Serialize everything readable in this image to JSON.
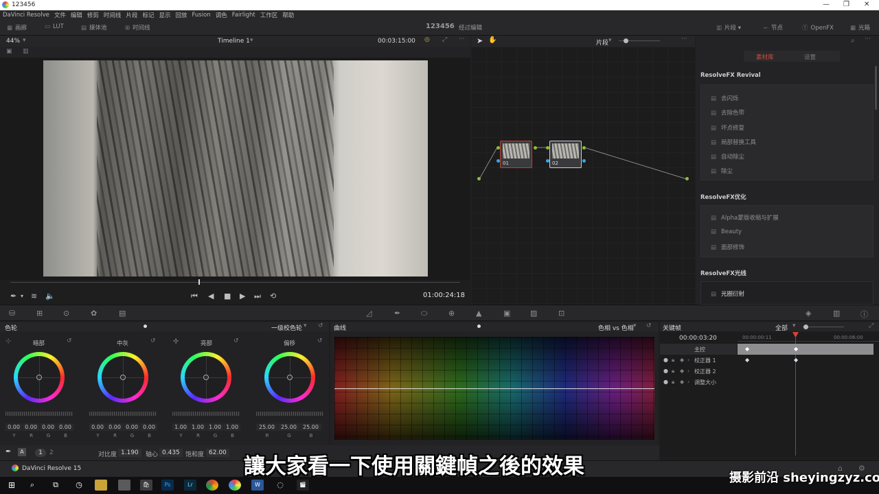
{
  "window": {
    "title": "123456"
  },
  "menu": [
    "DaVinci Resolve",
    "文件",
    "编辑",
    "修剪",
    "时间线",
    "片段",
    "标记",
    "显示",
    "回放",
    "Fusion",
    "调色",
    "Fairlight",
    "工作区",
    "帮助"
  ],
  "toolbar": {
    "left": [
      "画廊",
      "LUT",
      "媒体池",
      "时间线"
    ],
    "project": "123456",
    "status": "经过编辑",
    "right": [
      "片段",
      "节点",
      "OpenFX",
      "光箱"
    ]
  },
  "viewer": {
    "zoom": "44%",
    "timeline": "Timeline 1",
    "duration": "00:03:15:00",
    "timecode": "01:00:24:18"
  },
  "node_editor": {
    "mode": "片段",
    "nodes": [
      {
        "label": "01"
      },
      {
        "label": "02"
      }
    ]
  },
  "effects": {
    "tabs": [
      "素材库",
      "设置"
    ],
    "groups": [
      {
        "title": "ResolveFX Revival",
        "items": [
          "去闪烁",
          "去除色带",
          "坏点修复",
          "局部替换工具",
          "自动除尘",
          "除尘"
        ]
      },
      {
        "title": "ResolveFX优化",
        "items": [
          "Alpha蒙版收缩与扩展",
          "Beauty",
          "面部修饰"
        ]
      },
      {
        "title": "ResolveFX光线",
        "items": [
          "光圈衍射"
        ]
      }
    ]
  },
  "color_wheels": {
    "panel": "色轮",
    "mode": "一级校色轮",
    "wheels": [
      {
        "name": "暗部",
        "values": [
          "0.00",
          "0.00",
          "0.00",
          "0.00"
        ],
        "channels": [
          "Y",
          "R",
          "G",
          "B"
        ]
      },
      {
        "name": "中灰",
        "values": [
          "0.00",
          "0.00",
          "0.00",
          "0.00"
        ],
        "channels": [
          "Y",
          "R",
          "G",
          "B"
        ]
      },
      {
        "name": "亮部",
        "values": [
          "1.00",
          "1.00",
          "1.00",
          "1.00"
        ],
        "channels": [
          "Y",
          "R",
          "G",
          "B"
        ]
      },
      {
        "name": "偏移",
        "values": [
          "25.00",
          "25.00",
          "25.00"
        ],
        "channels": [
          "R",
          "G",
          "B"
        ]
      }
    ],
    "pages": [
      "1",
      "2"
    ],
    "adjust": [
      {
        "label": "对比度",
        "value": "1.190"
      },
      {
        "label": "轴心",
        "value": "0.435"
      },
      {
        "label": "饱和度",
        "value": "62.00"
      }
    ]
  },
  "curves": {
    "panel": "曲线",
    "mode": "色相 vs 色相"
  },
  "keyframes": {
    "panel": "关键帧",
    "filter": "全部",
    "timecode": "00:00:03:20",
    "ruler": [
      "00:00:00:11",
      "00:00:06:00"
    ],
    "rows": [
      "主控",
      "校正器 1",
      "校正器 2",
      "调整大小"
    ]
  },
  "footer": {
    "app": "DaVinci Resolve 15"
  },
  "subtitle": "讓大家看一下使用關鍵幀之後的效果",
  "watermark": "摄影前沿 sheyingzyz.com",
  "colors": {
    "accent": "#c24033",
    "panel": "#222224",
    "text": "#a9a9ab"
  }
}
